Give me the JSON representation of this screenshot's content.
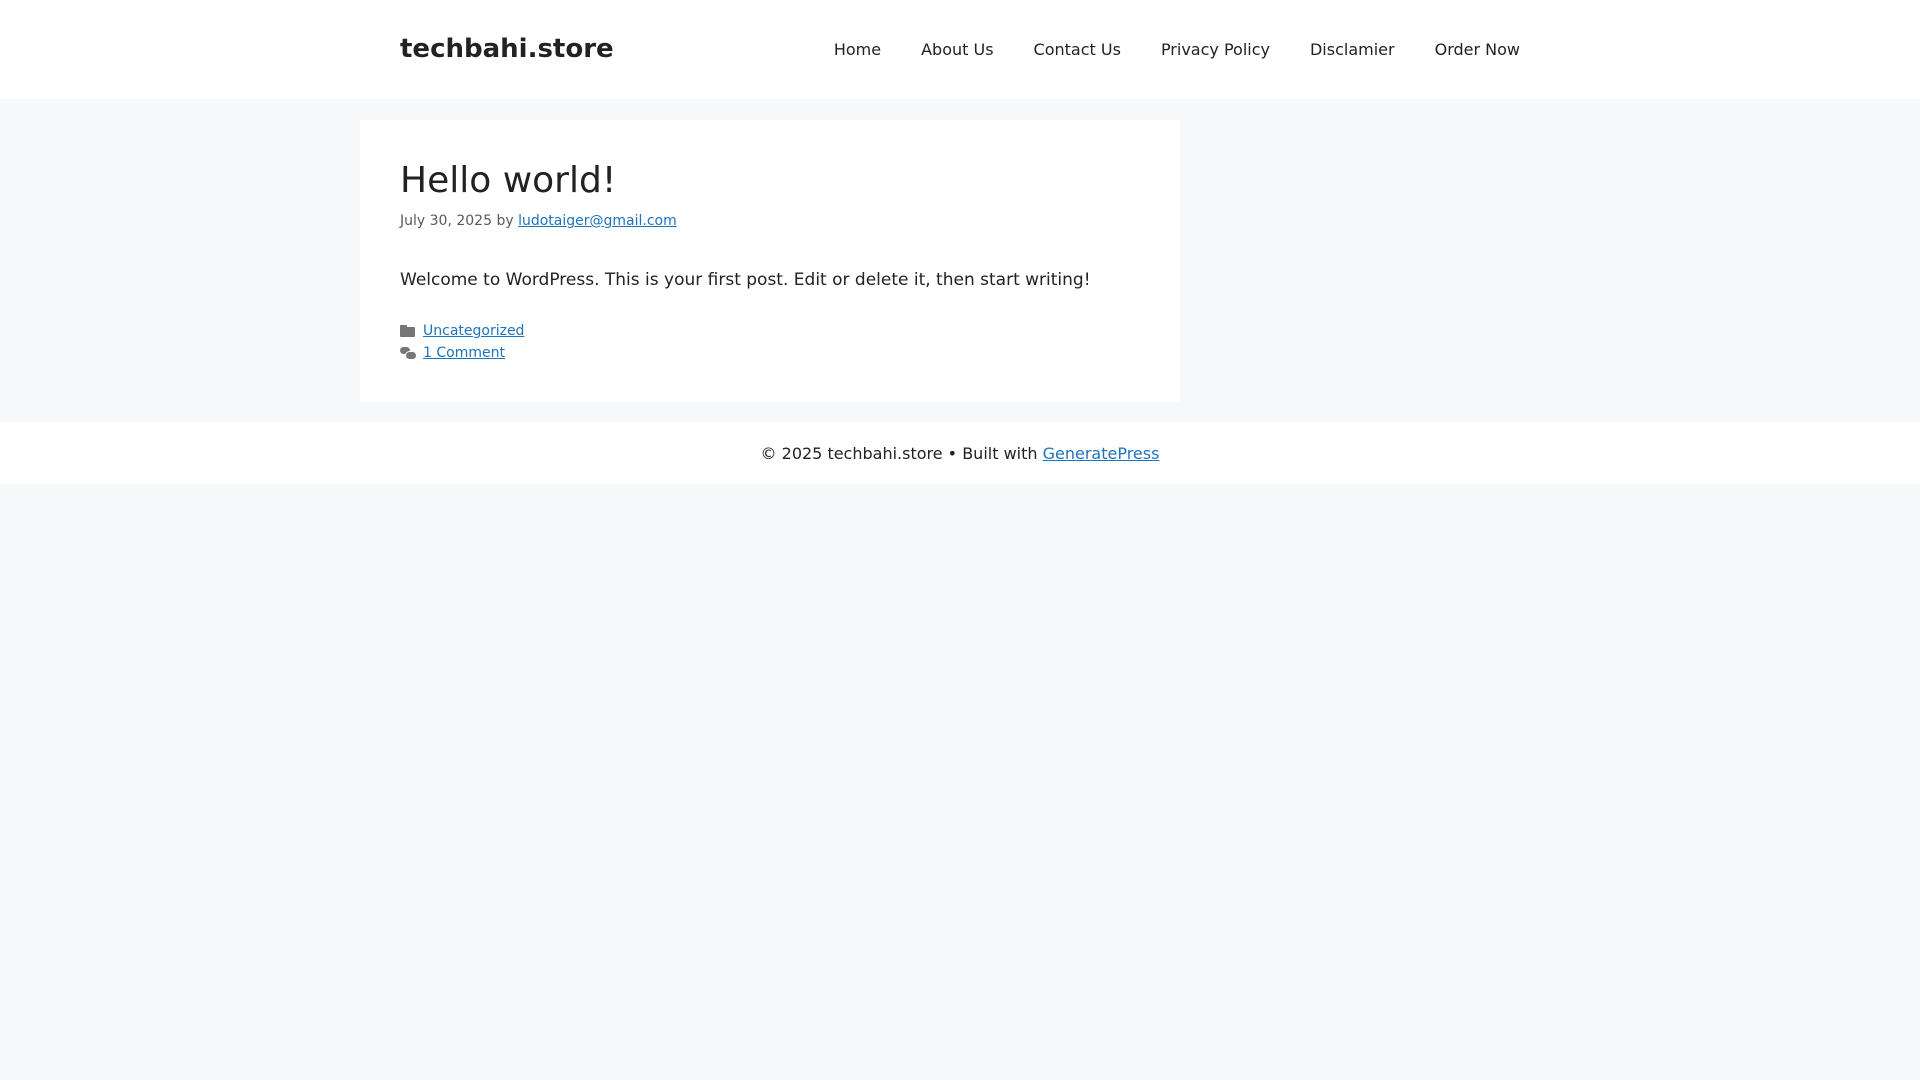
{
  "header": {
    "site_title": "techbahi.store",
    "nav": {
      "home": "Home",
      "about": "About Us",
      "contact": "Contact Us",
      "privacy": "Privacy Policy",
      "disclaimer": "Disclamier",
      "order": "Order Now"
    }
  },
  "post": {
    "title": "Hello world!",
    "date": "July 30, 2025",
    "by": "by",
    "author": "ludotaiger@gmail.com",
    "body": "Welcome to WordPress. This is your first post. Edit or delete it, then start writing!",
    "category": "Uncategorized",
    "comments": "1 Comment",
    "category_icon": "folder-icon",
    "comments_icon": "comments-icon"
  },
  "footer": {
    "copyright": "© 2025 techbahi.store • Built with",
    "theme_link": "GeneratePress"
  },
  "colors": {
    "background": "#f7f8f9",
    "link": "#1e73be",
    "text": "#222222"
  }
}
